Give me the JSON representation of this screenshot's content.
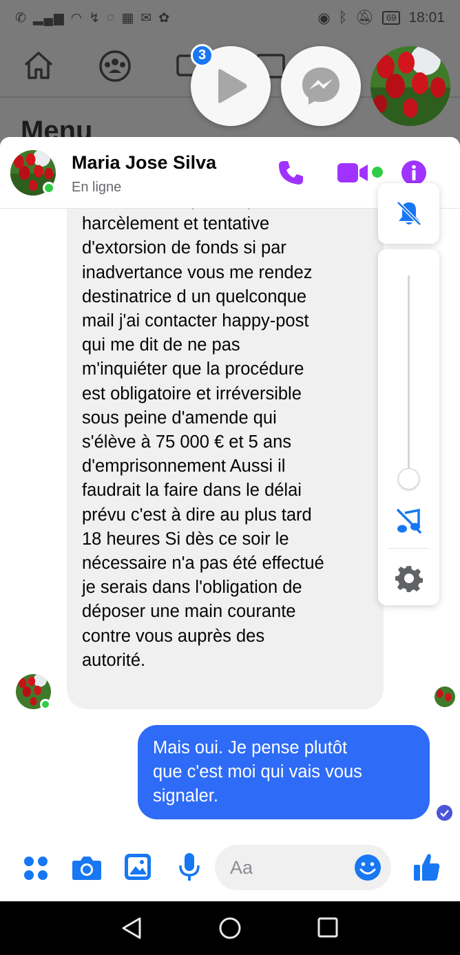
{
  "status_bar": {
    "left_icons": [
      "wifi-call-icon",
      "signal-icon",
      "wifi-icon",
      "missed-call-icon",
      "messenger-icon",
      "qr-icon",
      "mail-icon",
      "app-icon"
    ],
    "battery": "69",
    "time": "18:01"
  },
  "facebook_background": {
    "nav_icons": [
      "home-icon",
      "groups-icon",
      "watch-icon",
      "marketplace-icon"
    ],
    "menu_title": "Menu"
  },
  "chat_heads": {
    "badge_count": "3",
    "items": [
      "video-play-head",
      "messenger-head",
      "contact-avatar-head"
    ]
  },
  "header": {
    "name": "Maria Jose Silva",
    "status": "En ligne",
    "actions": [
      "phone-call",
      "video-call",
      "info"
    ],
    "colors": {
      "accent": "#a033ff",
      "online": "#31cc46"
    }
  },
  "side_controls": {
    "mute_label": "notifications muted",
    "volume_level": 0,
    "sound_off_label": "sound off",
    "settings_label": "settings"
  },
  "messages": {
    "received": {
      "partial_first_line": "... , je ... ... ... ... ...",
      "text": "vous ester en justice pour\nharcèlement et tentative\nd'extorsion de fonds si par\ninadvertance vous me rendez\ndestinatrice d un quelconque\nmail j'ai contacter happy-post\nqui me dit de ne pas\nm'inquiéter que la procédure\nest obligatoire et irréversible\nsous peine d'amende qui\ns'élève à 75 000 € et 5 ans\nd'emprisonnement  Aussi il\nfaudrait la faire dans le délai\nprévu c'est à dire au plus tard\n18 heures Si dès ce soir le\nnécessaire n'a pas été effectué\nje serais dans l'obligation de\ndéposer une main courante\ncontre vous auprès des\nautorité."
    },
    "sent": {
      "text": "Mais oui. Je pense plutôt\nque c'est moi qui vais vous\nsignaler."
    }
  },
  "composer": {
    "placeholder": "Aa",
    "buttons": [
      "more-apps",
      "camera",
      "gallery",
      "microphone",
      "emoji",
      "like"
    ],
    "accent": "#1877f2"
  },
  "android_nav": [
    "back",
    "home",
    "recents"
  ]
}
